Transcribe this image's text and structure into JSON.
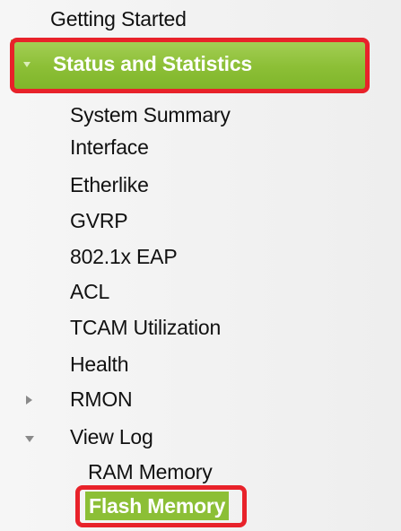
{
  "nav": {
    "top_item": "Getting Started",
    "section": {
      "label": "Status and Statistics"
    },
    "items": [
      "System Summary",
      "Interface",
      "Etherlike",
      "GVRP",
      "802.1x EAP",
      "ACL",
      "TCAM Utilization",
      "Health",
      "RMON",
      "View Log"
    ],
    "view_log_children": [
      "RAM Memory",
      "Flash Memory"
    ]
  },
  "colors": {
    "section_green": "#8cbf36",
    "highlight_red": "#e8222a",
    "expander_gray": "#8a8a8a"
  },
  "icons": {
    "section_expander": "caret-down-icon",
    "rmon_expander": "caret-right-icon",
    "view_log_expander": "caret-down-icon"
  }
}
